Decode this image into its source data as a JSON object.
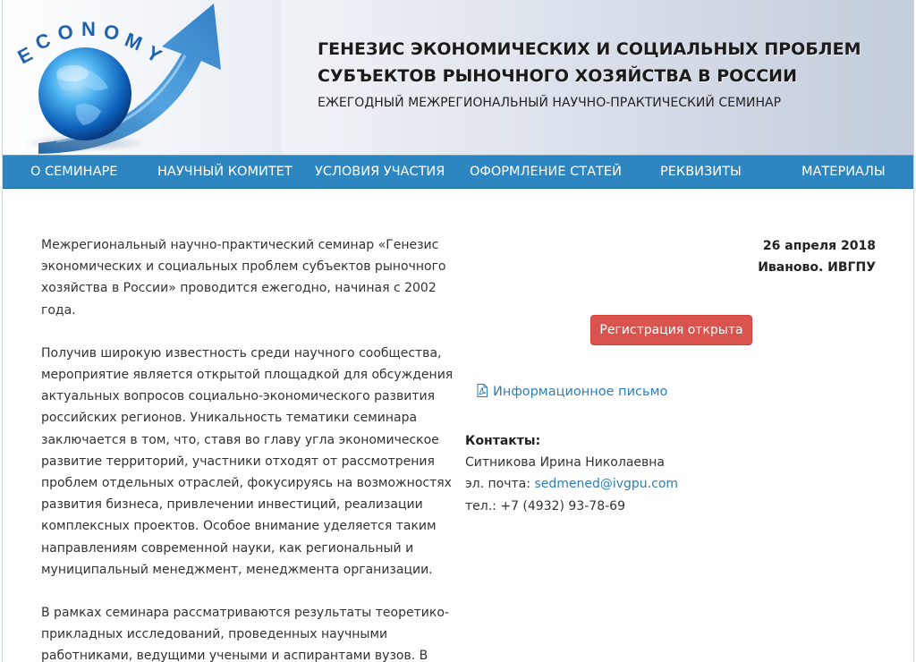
{
  "header": {
    "logo_text": "ECONOMY",
    "title_line1": "ГЕНЕЗИС ЭКОНОМИЧЕСКИХ И СОЦИАЛЬНЫХ ПРОБЛЕМ",
    "title_line2": "СУБЪЕКТОВ РЫНОЧНОГО ХОЗЯЙСТВА В РОССИИ",
    "subtitle": "ЕЖЕГОДНЫЙ МЕЖРЕГИОНАЛЬНЫЙ НАУЧНО-ПРАКТИЧЕСКИЙ СЕМИНАР"
  },
  "nav": {
    "items": [
      {
        "label": "О СЕМИНАРЕ"
      },
      {
        "label": "НАУЧНЫЙ КОМИТЕТ"
      },
      {
        "label": "УСЛОВИЯ УЧАСТИЯ"
      },
      {
        "label": "ОФОРМЛЕНИЕ СТАТЕЙ"
      },
      {
        "label": "РЕКВИЗИТЫ"
      },
      {
        "label": "МАТЕРИАЛЫ"
      }
    ]
  },
  "main": {
    "paragraph1": "Межрегиональный научно-практический семинар «Генезис экономических и социальных проблем субъектов рыночного хозяйства в России» проводится ежегодно, начиная с 2002 года.",
    "paragraph2": "Получив широкую известность среди научного сообщества, мероприятие является открытой площадкой для обсуждения актуальных вопросов социально-экономического развития российских регионов. Уникальность тематики семинара заключается в том, что, ставя во главу угла экономическое развитие территорий, участники отходят от рассмотрения проблем отдельных отраслей, фокусируясь на возможностях развития бизнеса, привлечении инвестиций, реализации комплексных проектов. Особое внимание уделяется таким направлениям современной науки, как региональный и муниципальный менеджмент, менеджмента организации.",
    "paragraph3": "В рамках семинара рассматриваются результаты теоретико-прикладных исследований, проведенных научными работниками, ведущими учеными и аспирантами вузов. В"
  },
  "event": {
    "date": "26 апреля 2018",
    "place": "Иваново. ИВГПУ"
  },
  "registration": {
    "label": "Регистрация открыта"
  },
  "info_letter": {
    "label": "Информационное письмо",
    "icon": "pdf-file-icon"
  },
  "contacts": {
    "heading": "Контакты:",
    "name": "Ситникова Ирина Николаевна",
    "email_label": "эл. почта:",
    "email": "sedmened@ivgpu.com",
    "phone": "тел.: +7 (4932) 93-78-69"
  },
  "colors": {
    "nav_bg": "#2d86bf",
    "button_bg": "#d9534f",
    "link": "#2a7fb8"
  }
}
